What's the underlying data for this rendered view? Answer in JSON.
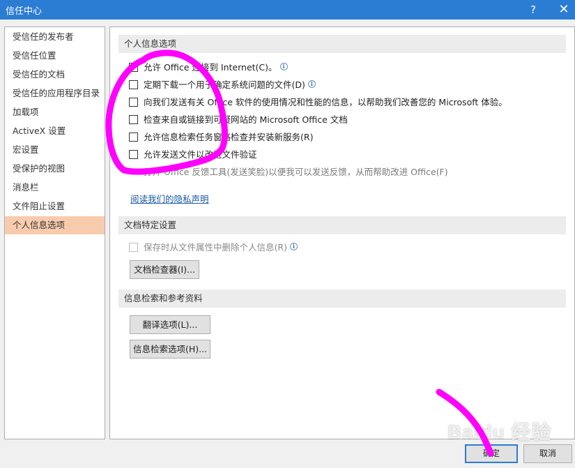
{
  "window": {
    "title": "信任中心",
    "help_glyph": "?",
    "close_glyph": "✕"
  },
  "sidebar": {
    "items": [
      {
        "label": "受信任的发布者"
      },
      {
        "label": "受信任位置"
      },
      {
        "label": "受信任的文档"
      },
      {
        "label": "受信任的应用程序目录"
      },
      {
        "label": "加载项"
      },
      {
        "label": "ActiveX 设置"
      },
      {
        "label": "宏设置"
      },
      {
        "label": "受保护的视图"
      },
      {
        "label": "消息栏"
      },
      {
        "label": "文件阻止设置"
      },
      {
        "label": "个人信息选项"
      }
    ],
    "selected_index": 10
  },
  "personal": {
    "header": "个人信息选项",
    "options": [
      {
        "label": "允许 Office 连接到 Internet(C)。",
        "checked": false
      },
      {
        "label": "定期下载一个用于确定系统问题的文件(D)",
        "checked": false
      },
      {
        "label": "向我们发送有关 Office 软件的使用情况和性能的信息，以帮助我们改善您的 Microsoft 体验。",
        "checked": false
      },
      {
        "label": "检查来自或链接到可疑网站的 Microsoft Office 文档",
        "checked": false
      },
      {
        "label": "允许信息检索任务窗格检查并安装新服务(R)",
        "checked": false
      },
      {
        "label": "允许发送文件以改进文件验证",
        "checked": false
      }
    ],
    "feedback_text": "打开 Office 反馈工具(发送笑脸)以便我可以发送反馈，从而帮助改进 Office(F)",
    "privacy_link": "阅读我们的隐私声明"
  },
  "document": {
    "header": "文档特定设置",
    "remove_info_label": "保存时从文件属性中删除个人信息(R)",
    "inspector_button": "文档检查器(I)..."
  },
  "research": {
    "header": "信息检索和参考资料",
    "translate_button": "翻译选项(L)...",
    "research_button": "信息检索选项(H)..."
  },
  "footer": {
    "ok": "确定",
    "cancel": "取消"
  },
  "watermark": {
    "text": "Baidu 经验"
  },
  "colors": {
    "titlebar": "#2b7cd3",
    "selected_nav": "#f8cbad",
    "annotation": "#ff00ff",
    "link": "#1a5aa8"
  }
}
